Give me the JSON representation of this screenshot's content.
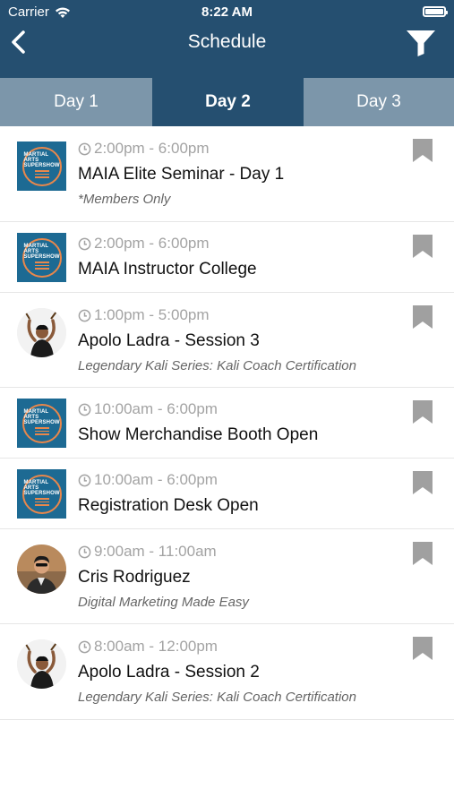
{
  "status_bar": {
    "carrier": "Carrier",
    "time": "8:22 AM"
  },
  "nav": {
    "title": "Schedule",
    "back_icon": "chevron-left-icon",
    "filter_icon": "filter-icon"
  },
  "tabs": [
    {
      "label": "Day 1",
      "selected": false
    },
    {
      "label": "Day 2",
      "selected": true
    },
    {
      "label": "Day 3",
      "selected": false
    }
  ],
  "logo": {
    "line1": "MARTIAL ARTS",
    "line2": "SUPERSHOW"
  },
  "events": [
    {
      "time": "2:00pm - 6:00pm",
      "name": "MAIA Elite Seminar - Day 1",
      "subtitle": "*Members Only",
      "thumb": "logo"
    },
    {
      "time": "2:00pm - 6:00pm",
      "name": "MAIA Instructor College",
      "subtitle": "",
      "thumb": "logo"
    },
    {
      "time": "1:00pm - 5:00pm",
      "name": "Apolo Ladra - Session 3",
      "subtitle": "Legendary Kali Series: Kali Coach Certification",
      "thumb": "person-kali"
    },
    {
      "time": "10:00am - 6:00pm",
      "name": "Show Merchandise Booth Open",
      "subtitle": "",
      "thumb": "logo"
    },
    {
      "time": "10:00am - 6:00pm",
      "name": "Registration Desk Open",
      "subtitle": "",
      "thumb": "logo"
    },
    {
      "time": "9:00am - 11:00am",
      "name": "Cris Rodriguez",
      "subtitle": "Digital Marketing Made Easy",
      "thumb": "person-cris"
    },
    {
      "time": "8:00am - 12:00pm",
      "name": "Apolo Ladra - Session 2",
      "subtitle": "Legendary Kali Series: Kali Coach Certification",
      "thumb": "person-kali"
    }
  ],
  "colors": {
    "header": "#254f70",
    "tab_inactive": "#7c96aa",
    "logo_bg": "#1d6a93",
    "logo_accent": "#e9874b",
    "bookmark": "#a0a0a0"
  }
}
